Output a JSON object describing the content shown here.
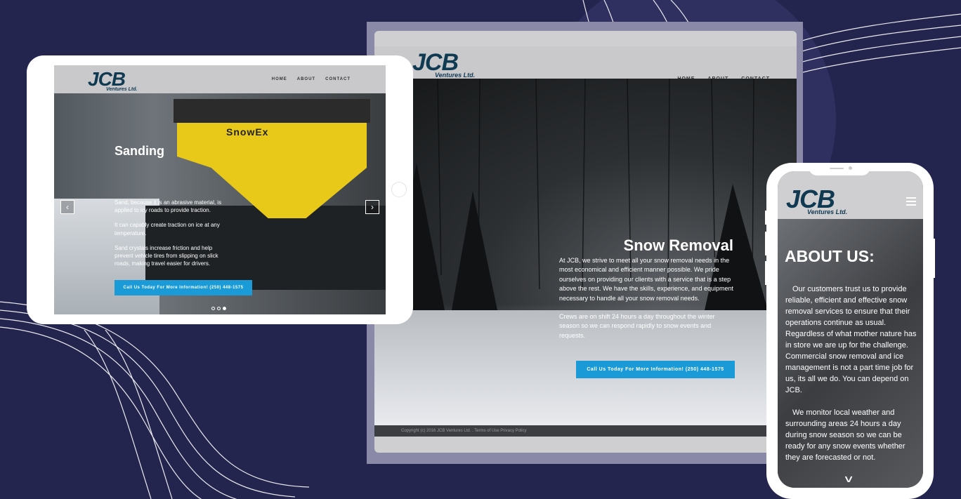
{
  "desktop": {
    "logo_main": "JCB",
    "logo_sub": "Ventures Ltd.",
    "nav": [
      "HOME",
      "ABOUT",
      "CONTACT"
    ],
    "hero_title": "Snow Removal",
    "hero_paragraphs": [
      "At JCB, we strive to meet all your snow removal needs in the most economical and efficient manner possible. We pride ourselves on providing our clients with a service that is a step above the rest. We have the skills, experience, and equipment necessary to handle all your snow removal needs.",
      "Crews are on shift 24 hours a day throughout the winter season so we can respond rapidly to snow events and requests."
    ],
    "cta": "Call Us Today For More Information! (250) 448-1575",
    "footer": "Copyright (c) 2016 JCB Ventures Ltd. . Terms of Use Privacy Policy",
    "slide_active": 1,
    "slide_count": 3
  },
  "tablet": {
    "logo_main": "JCB",
    "logo_sub": "Ventures Ltd.",
    "nav": [
      "HOME",
      "ABOUT",
      "CONTACT"
    ],
    "hero_title": "Sanding",
    "hero_paragraphs": [
      "Sand, because it is an abrasive material, is applied to icy roads to provide traction.",
      "It can capably create traction on ice at any temperature.",
      "Sand crystals increase friction and help prevent vehicle tires from slipping on slick roads, making travel easier for drivers."
    ],
    "equipment_brand": "SnowEx",
    "cta": "Call Us Today For More Information! (250) 448-1575",
    "prev_icon": "chevron-left-icon",
    "next_icon": "chevron-right-icon",
    "slide_active": 3,
    "slide_count": 3
  },
  "phone": {
    "logo_main": "JCB",
    "logo_sub": "Ventures Ltd.",
    "menu_icon": "hamburger-icon",
    "title": "ABOUT US:",
    "paragraphs": [
      "Our customers trust us to provide reliable, efficient and effective snow removal services to ensure that their operations continue as usual. Regardless of what mother nature has in store we are up for the challenge. Commercial snow removal and ice management is not a part time job for us, its all we do. You can depend on JCB.",
      "We monitor local weather and surrounding areas 24 hours a day during snow season so we can be ready for any snow events whether they are forecasted or not."
    ],
    "scroll_icon": "chevron-down-icon"
  },
  "colors": {
    "background": "#24254f",
    "accent": "#1a9ad6",
    "logo": "#103a52"
  }
}
